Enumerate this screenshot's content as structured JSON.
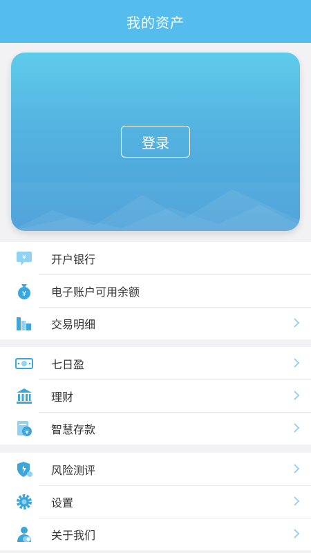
{
  "header": {
    "title": "我的资产"
  },
  "card": {
    "login_label": "登录"
  },
  "groups": [
    {
      "items": [
        {
          "label": "开户银行",
          "icon": "bank-card-icon",
          "chevron": false
        },
        {
          "label": "电子账户可用余额",
          "icon": "money-bag-icon",
          "chevron": false
        },
        {
          "label": "交易明细",
          "icon": "bar-chart-icon",
          "chevron": true
        }
      ]
    },
    {
      "items": [
        {
          "label": "七日盈",
          "icon": "banknote-icon",
          "chevron": true
        },
        {
          "label": "理财",
          "icon": "bank-building-icon",
          "chevron": true
        },
        {
          "label": "智慧存款",
          "icon": "deposit-icon",
          "chevron": true
        }
      ]
    },
    {
      "items": [
        {
          "label": "风险测评",
          "icon": "shield-icon",
          "chevron": true
        },
        {
          "label": "设置",
          "icon": "gear-icon",
          "chevron": true
        },
        {
          "label": "关于我们",
          "icon": "user-info-icon",
          "chevron": true
        }
      ]
    }
  ],
  "colors": {
    "header": "#55bdee",
    "icon_primary": "#3aa6dc",
    "icon_light": "#8fd2f2",
    "chevron": "#8bc8ea"
  }
}
